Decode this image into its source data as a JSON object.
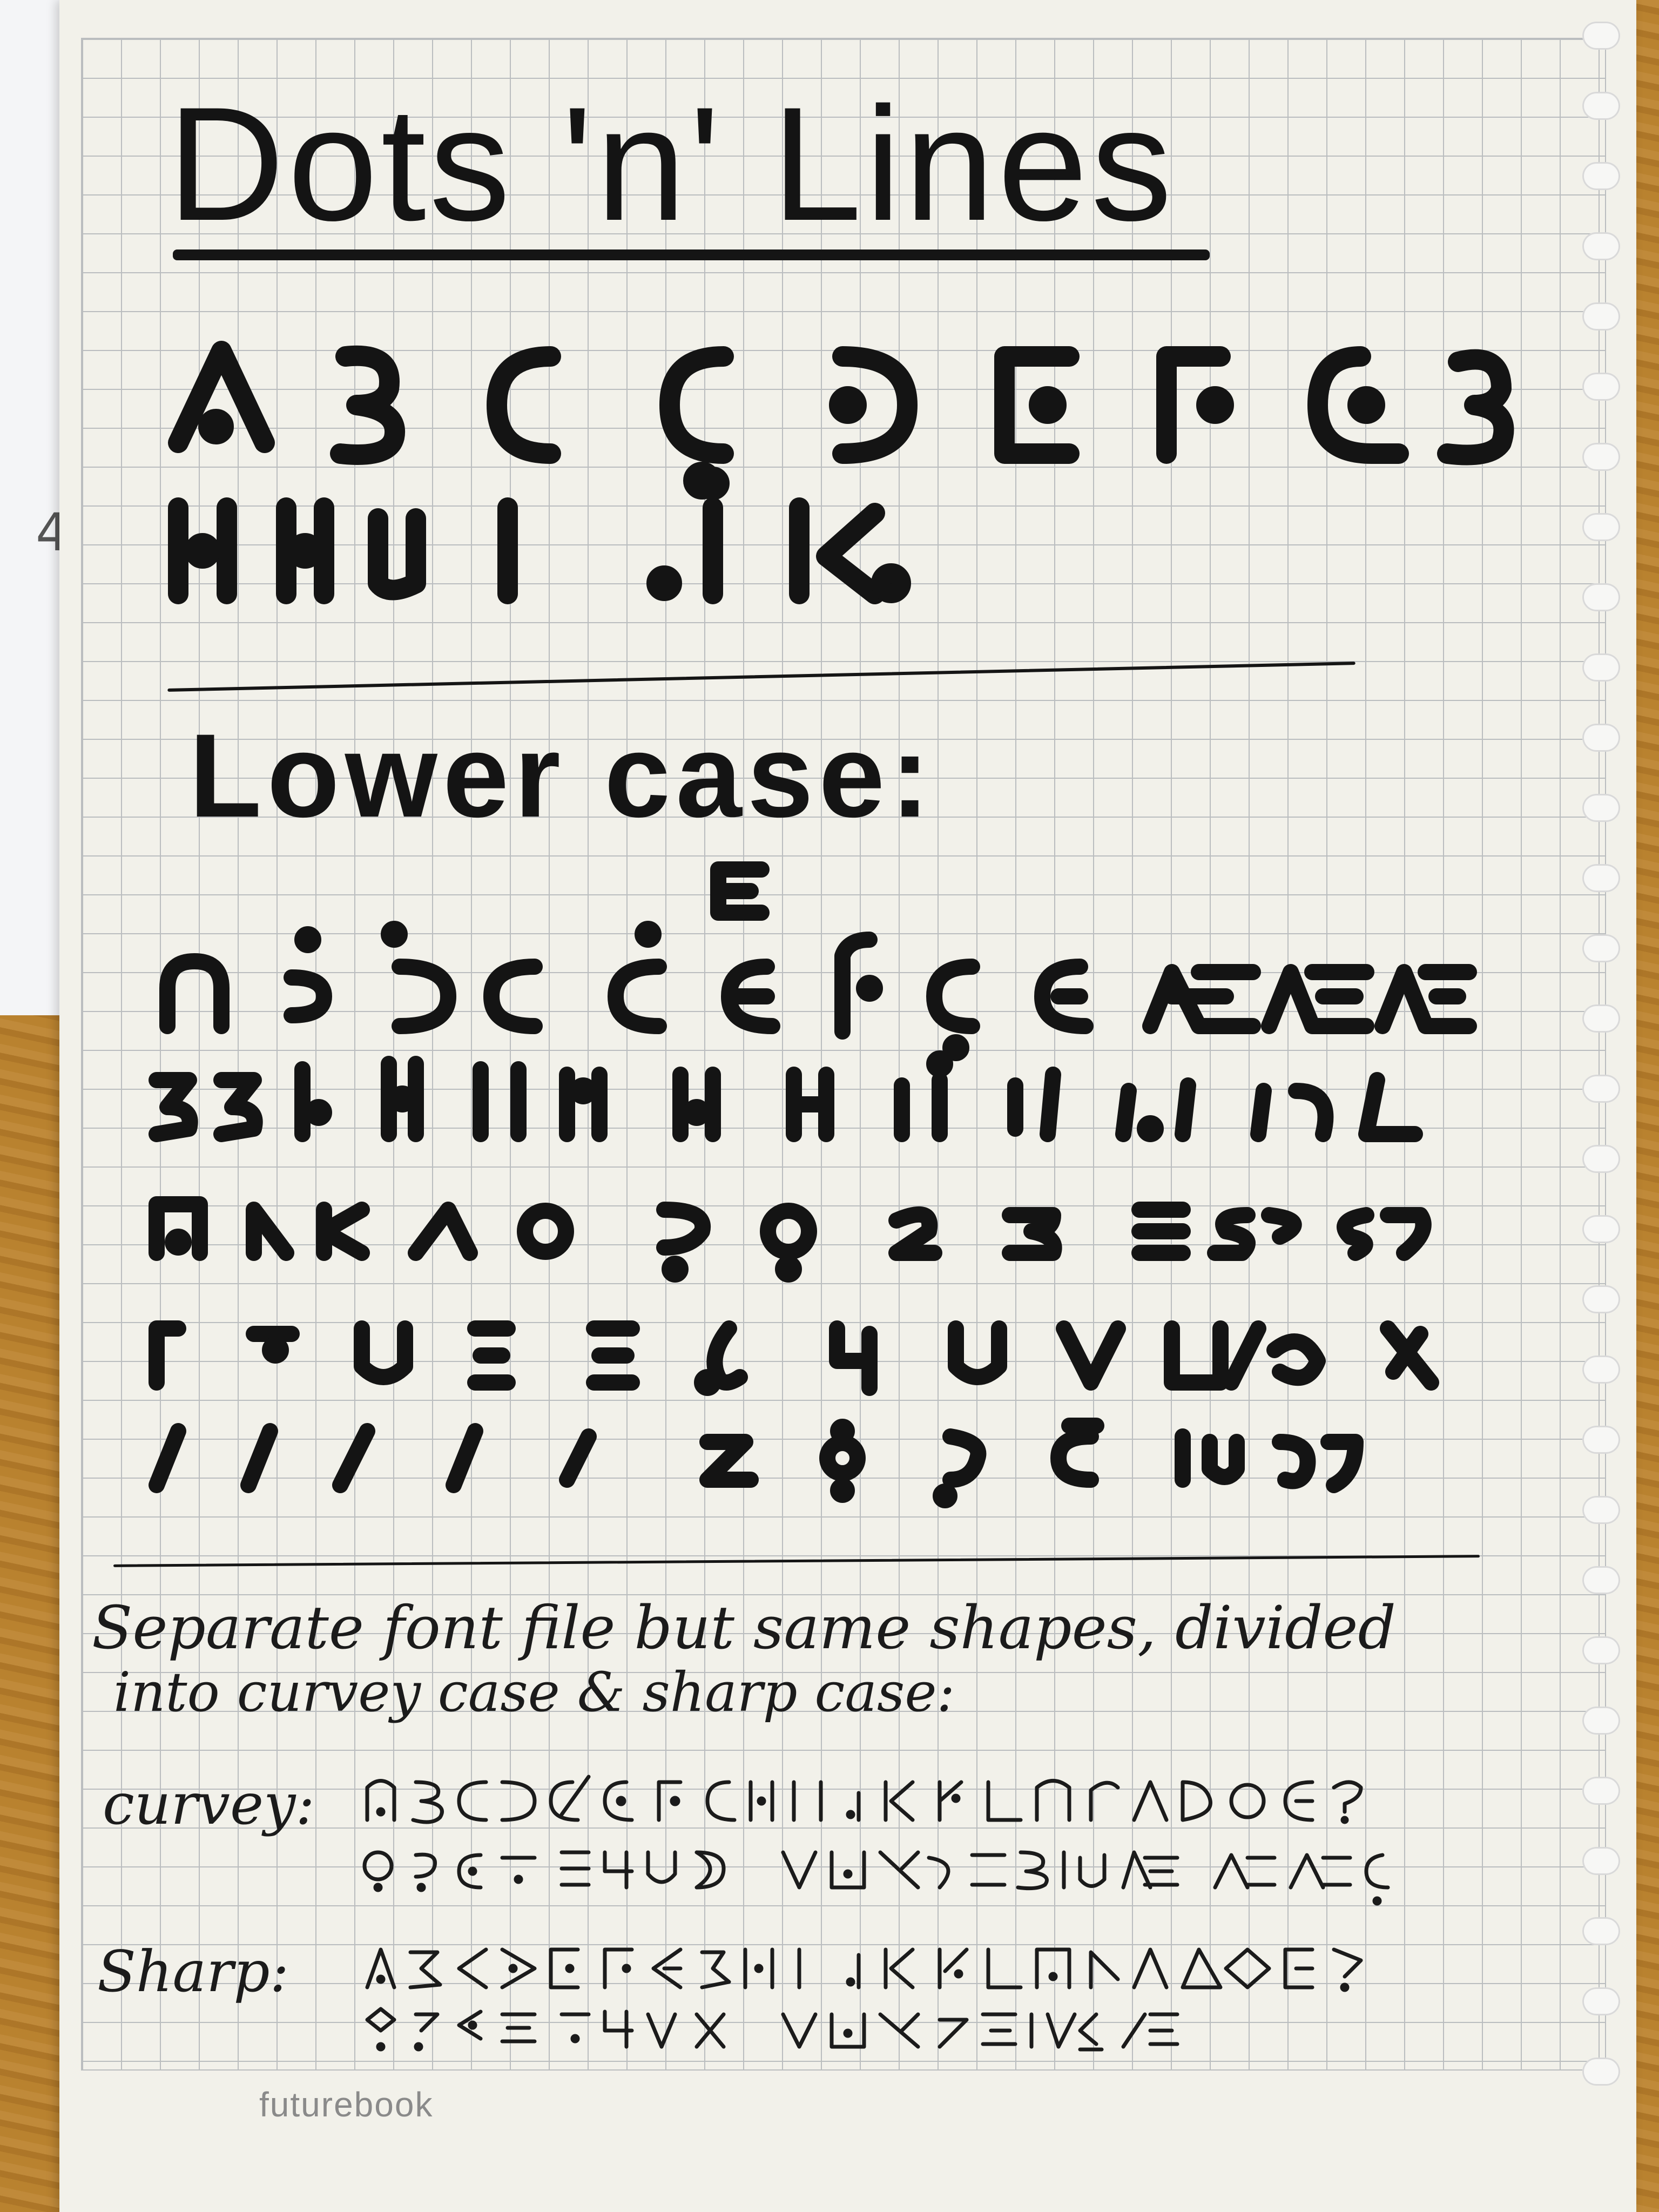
{
  "margin_number": "4",
  "title": "Dots 'n' Lines",
  "lower_case_heading": "Lower case:",
  "note_line1": "Separate font file but same shapes, divided",
  "note_line2": "into curvey case & sharp case:",
  "curvey_label": "curvey:",
  "sharp_label": "Sharp:",
  "brand": "futurebook",
  "colors": {
    "ink": "#141414",
    "paper": "#f2f1ea",
    "grid": "#8d949c",
    "table": "#b27c2e"
  }
}
